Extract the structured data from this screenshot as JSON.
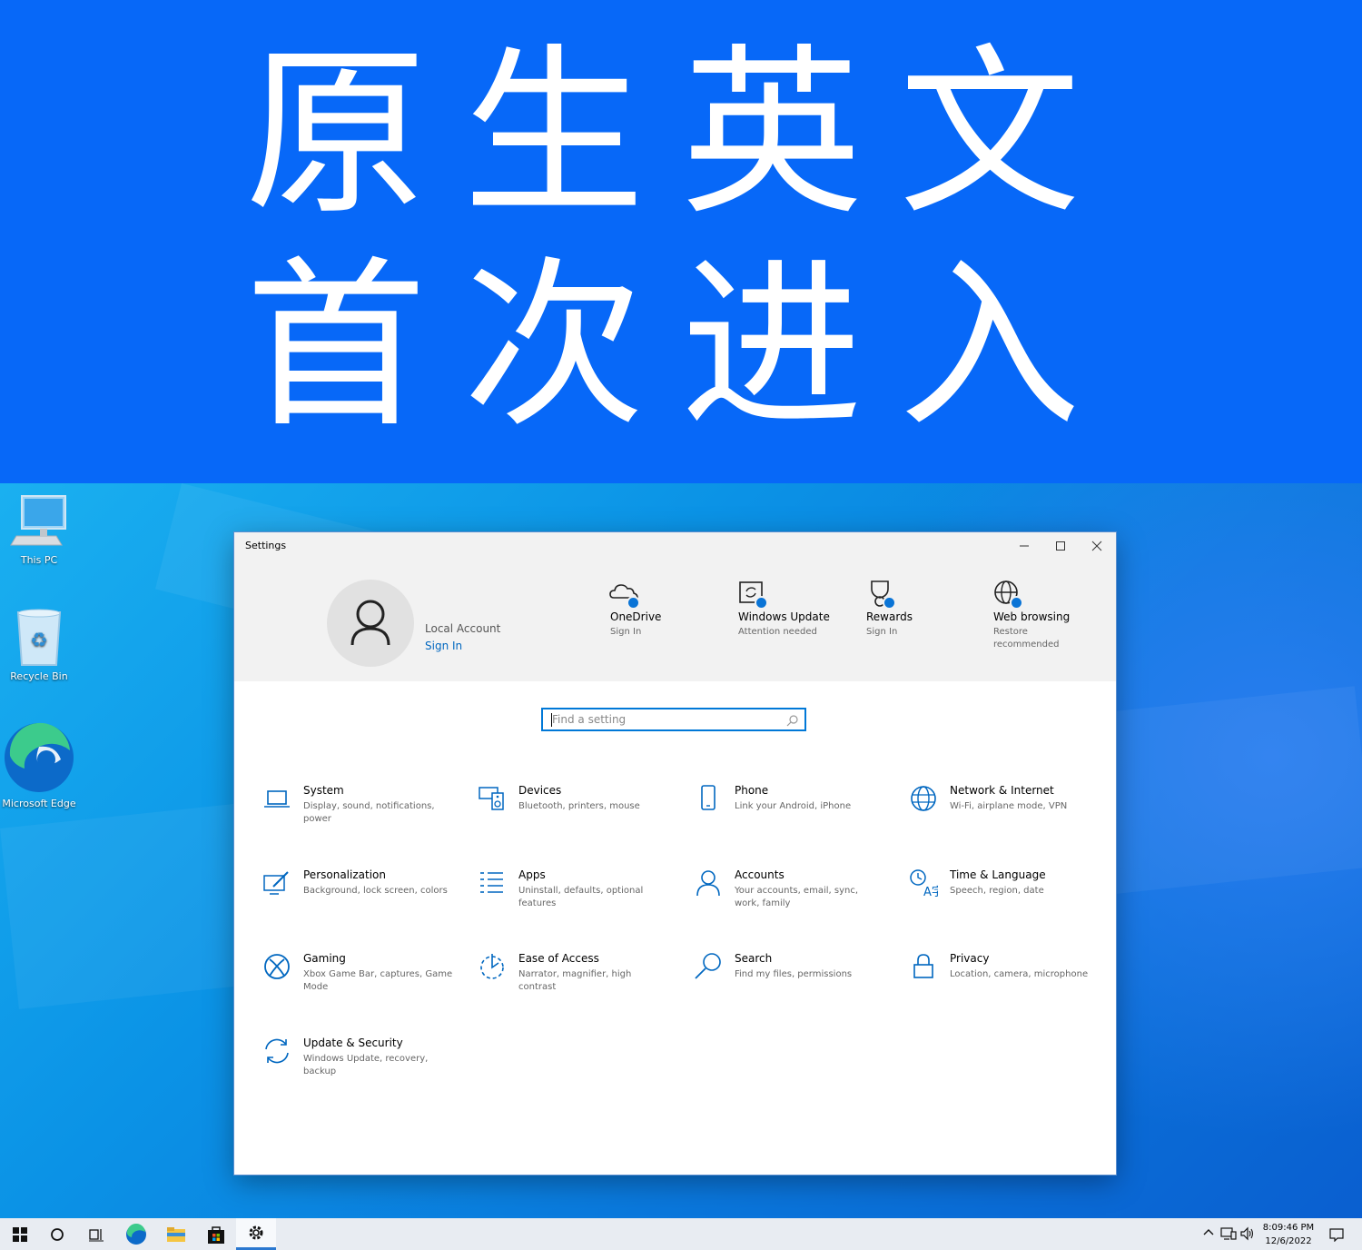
{
  "banner": {
    "line1": "原生英文",
    "line2": "首次进入"
  },
  "desktop_icons": [
    {
      "label": "This PC"
    },
    {
      "label": "Recycle Bin"
    },
    {
      "label": "Microsoft Edge"
    }
  ],
  "window": {
    "title": "Settings",
    "account": {
      "name": "Local Account",
      "sign_in": "Sign In"
    },
    "header_items": [
      {
        "name": "OneDrive",
        "sub": "Sign In",
        "icon": "onedrive-cloud-icon"
      },
      {
        "name": "Windows Update",
        "sub": "Attention needed",
        "icon": "windows-update-icon"
      },
      {
        "name": "Rewards",
        "sub": "Sign In",
        "icon": "rewards-trophy-icon"
      },
      {
        "name": "Web browsing",
        "sub": "Restore recommended",
        "icon": "globe-icon"
      }
    ],
    "search": {
      "placeholder": "Find a setting"
    },
    "categories": [
      {
        "name": "System",
        "desc": "Display, sound, notifications, power",
        "icon": "laptop-icon"
      },
      {
        "name": "Devices",
        "desc": "Bluetooth, printers, mouse",
        "icon": "keyboard-speaker-icon"
      },
      {
        "name": "Phone",
        "desc": "Link your Android, iPhone",
        "icon": "phone-icon"
      },
      {
        "name": "Network & Internet",
        "desc": "Wi-Fi, airplane mode, VPN",
        "icon": "globe-icon"
      },
      {
        "name": "Personalization",
        "desc": "Background, lock screen, colors",
        "icon": "paint-brush-icon"
      },
      {
        "name": "Apps",
        "desc": "Uninstall, defaults, optional features",
        "icon": "apps-list-icon"
      },
      {
        "name": "Accounts",
        "desc": "Your accounts, email, sync, work, family",
        "icon": "person-icon"
      },
      {
        "name": "Time & Language",
        "desc": "Speech, region, date",
        "icon": "time-language-icon"
      },
      {
        "name": "Gaming",
        "desc": "Xbox Game Bar, captures, Game Mode",
        "icon": "xbox-icon"
      },
      {
        "name": "Ease of Access",
        "desc": "Narrator, magnifier, high contrast",
        "icon": "ease-of-access-icon"
      },
      {
        "name": "Search",
        "desc": "Find my files, permissions",
        "icon": "search-icon"
      },
      {
        "name": "Privacy",
        "desc": "Location, camera, microphone",
        "icon": "lock-icon"
      },
      {
        "name": "Update & Security",
        "desc": "Windows Update, recovery, backup",
        "icon": "sync-arrows-icon"
      }
    ]
  },
  "taskbar": {
    "clock": {
      "time": "8:09:46 PM",
      "date": "12/6/2022"
    }
  },
  "colors": {
    "banner_bg": "#0768f8",
    "accent": "#0078d7",
    "icon_blue": "#0067c0"
  }
}
